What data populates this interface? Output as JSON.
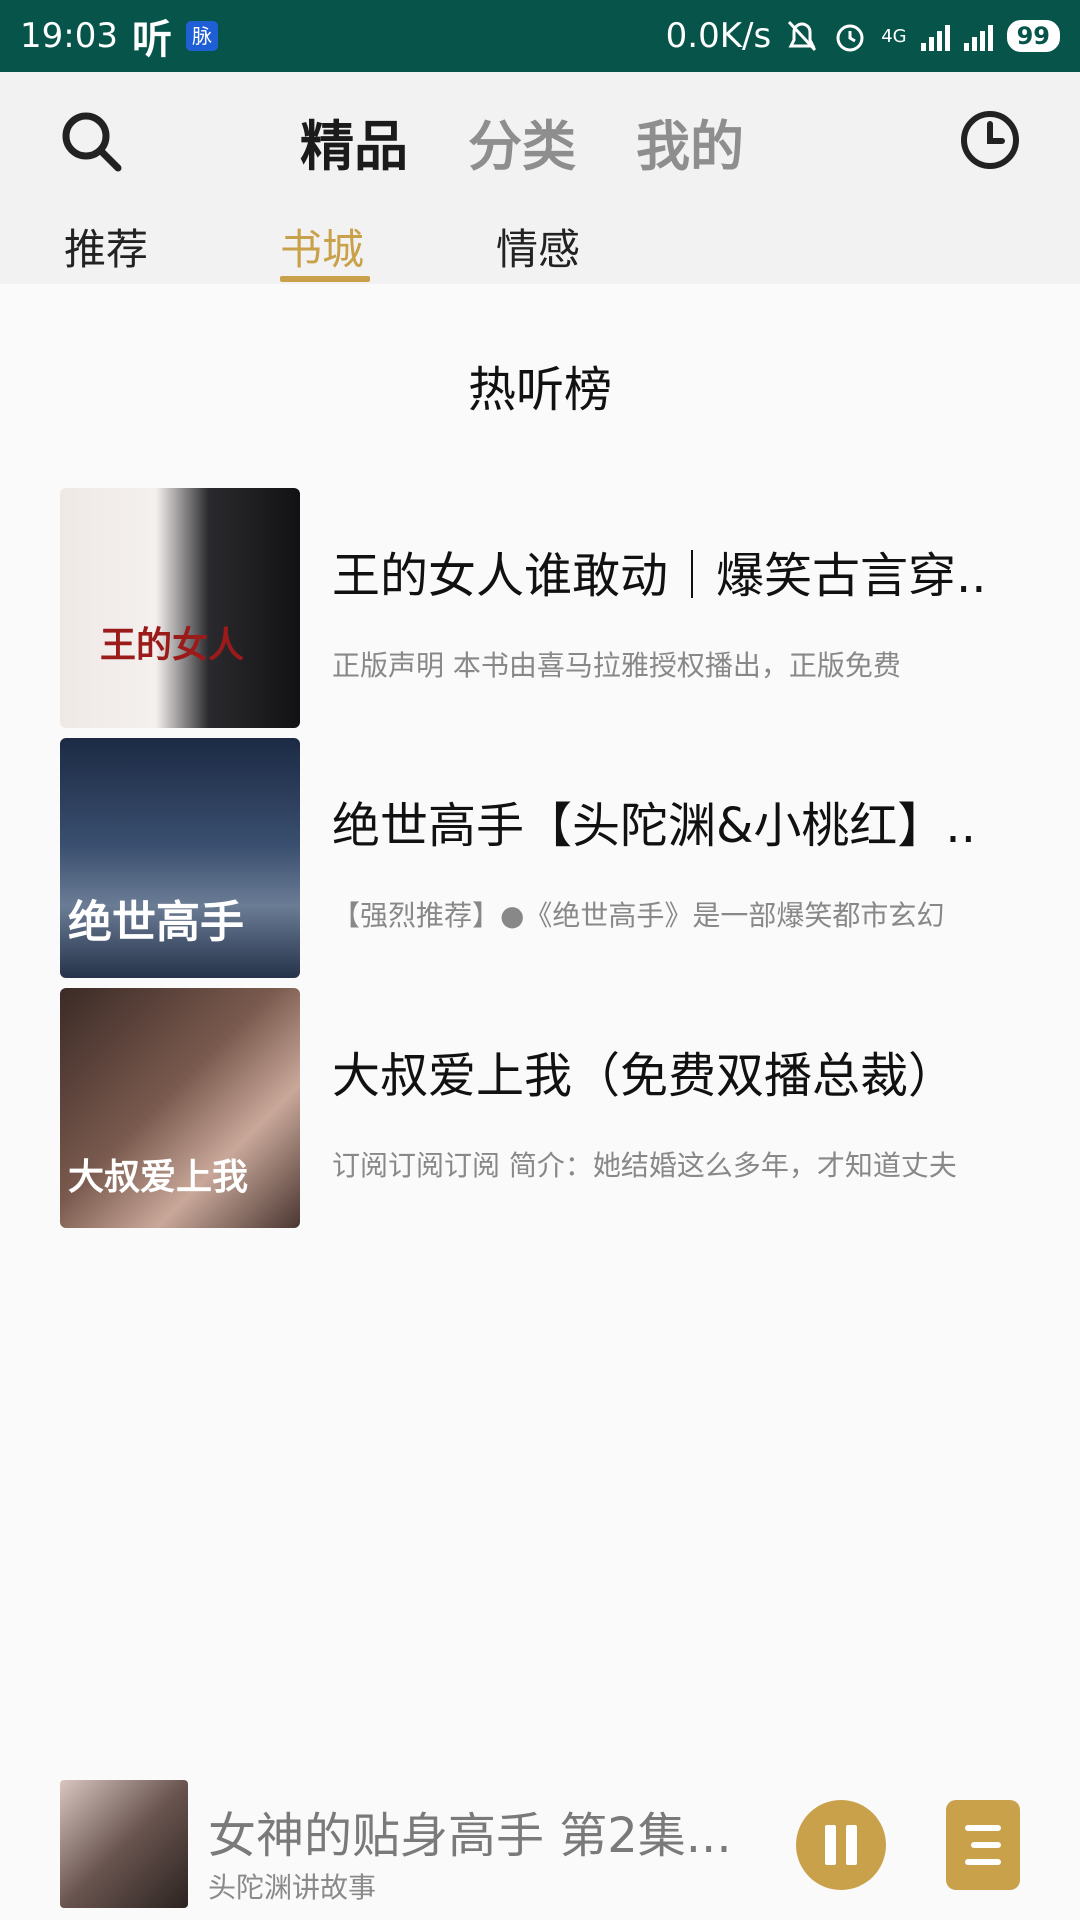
{
  "status_bar": {
    "time": "19:03",
    "app_glyph": "听",
    "badge": "脉",
    "net_speed": "0.0K/s",
    "network": "4G",
    "battery": "99"
  },
  "header": {
    "tabs": [
      "精品",
      "分类",
      "我的"
    ],
    "sub_tabs": [
      "推荐",
      "书城",
      "情感"
    ]
  },
  "section": {
    "title": "热听榜"
  },
  "books": [
    {
      "title": "王的女人谁敢动｜爆笑古言穿..",
      "desc": "正版声明   本书由喜马拉雅授权播出，正版免费",
      "cover_text": "王的女人"
    },
    {
      "title": "绝世高手【头陀渊&小桃红】..",
      "desc": "【强烈推荐】●《绝世高手》是一部爆笑都市玄幻",
      "cover_text": "绝世高手"
    },
    {
      "title": "大叔爱上我（免费双播总裁）",
      "desc": "订阅订阅订阅 简介：她结婚这么多年，才知道丈夫",
      "cover_text": "大叔爱上我"
    }
  ],
  "player": {
    "title": "女神的贴身高手 第2集...",
    "subtitle": "头陀渊讲故事"
  },
  "colors": {
    "status_bar": "#07554a",
    "accent": "#c9a14a",
    "header_bg": "#f2f2f2"
  }
}
